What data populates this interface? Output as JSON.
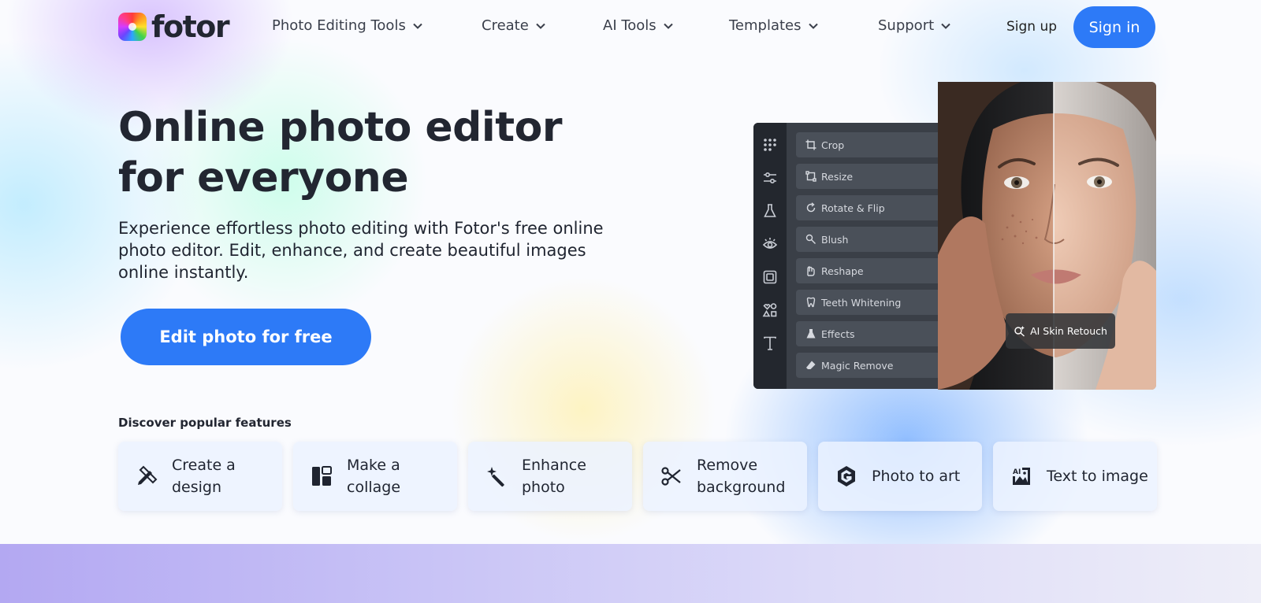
{
  "brand": {
    "name": "fotor"
  },
  "nav": {
    "items": [
      {
        "label": "Photo Editing Tools"
      },
      {
        "label": "Create"
      },
      {
        "label": "AI Tools"
      },
      {
        "label": "Templates"
      },
      {
        "label": "Support"
      }
    ],
    "signup_label": "Sign up",
    "signin_label": "Sign in"
  },
  "hero": {
    "title": "Online photo editor for everyone",
    "subtitle": "Experience effortless photo editing with Fotor's free online photo editor. Edit, enhance, and create beautiful images online instantly.",
    "cta_label": "Edit photo for free"
  },
  "editor_mock": {
    "rail_icons": [
      "grid-icon",
      "sliders-icon",
      "flask-icon",
      "eye-icon",
      "frame-icon",
      "shapes-icon",
      "text-icon"
    ],
    "tools": [
      {
        "label": "Crop",
        "icon": "crop-icon"
      },
      {
        "label": "Resize",
        "icon": "resize-icon"
      },
      {
        "label": "Rotate & Flip",
        "icon": "rotate-icon"
      },
      {
        "label": "Blush",
        "icon": "blush-icon"
      },
      {
        "label": "Reshape",
        "icon": "reshape-icon"
      },
      {
        "label": "Teeth Whitening",
        "icon": "tooth-icon"
      },
      {
        "label": "Effects",
        "icon": "flask-icon"
      },
      {
        "label": "Magic Remove",
        "icon": "eraser-icon"
      }
    ],
    "badge_label": "AI Skin Retouch"
  },
  "features": {
    "heading": "Discover popular features",
    "items": [
      {
        "label": "Create a design",
        "icon": "pencil-ruler-icon"
      },
      {
        "label": "Make a collage",
        "icon": "collage-icon"
      },
      {
        "label": "Enhance photo",
        "icon": "magic-wand-icon"
      },
      {
        "label": "Remove background",
        "icon": "scissors-icon"
      },
      {
        "label": "Photo to art",
        "icon": "art-g-icon"
      },
      {
        "label": "Text to image",
        "icon": "ai-image-icon"
      }
    ]
  },
  "colors": {
    "primary": "#2d7af7",
    "text": "#222631"
  }
}
